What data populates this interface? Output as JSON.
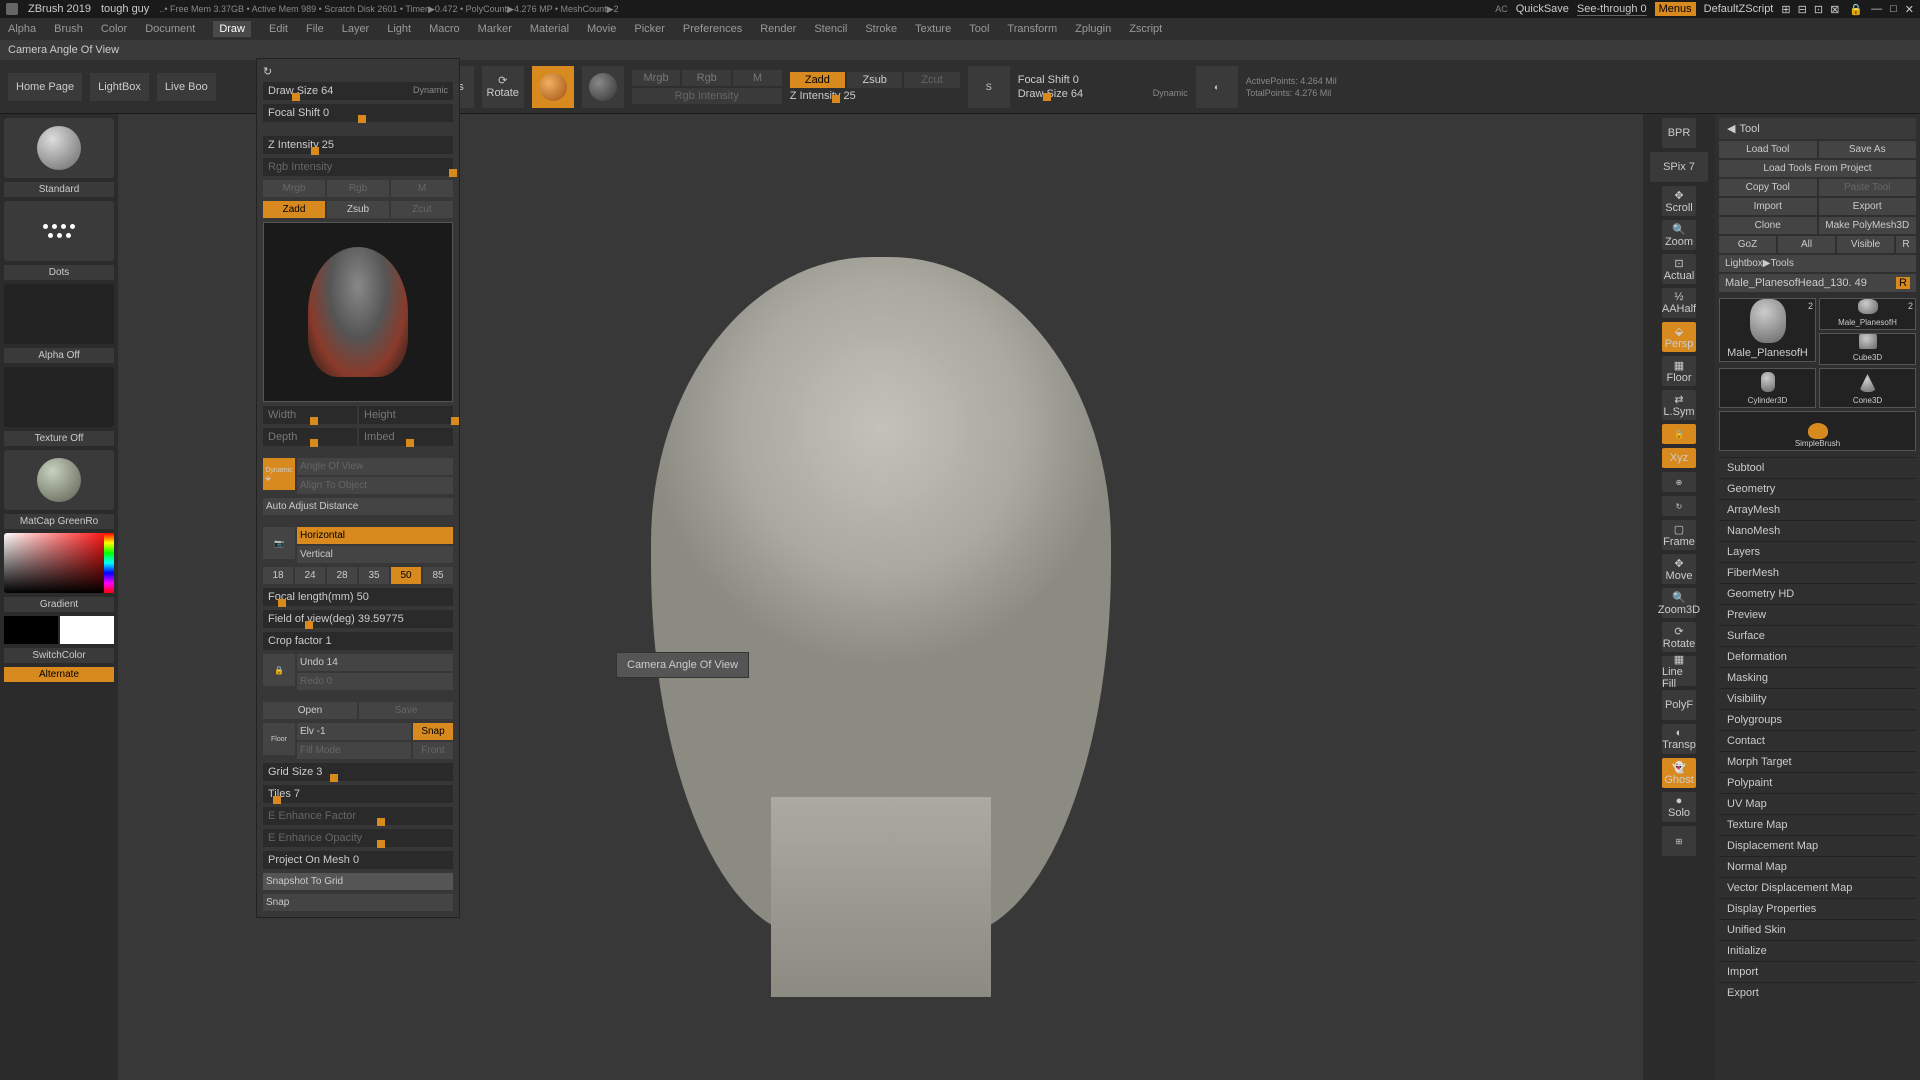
{
  "title": {
    "app": "ZBrush 2019",
    "project": "tough guy",
    "status": "..• Free Mem 3.37GB • Active Mem 989 • Scratch Disk 2601 • Timer▶0.472 • PolyCount▶4.276 MP • MeshCount▶2"
  },
  "titlebar_right": {
    "ac": "AC",
    "quicksave": "QuickSave",
    "seethrough": "See-through  0",
    "menus": "Menus",
    "zscript": "DefaultZScript"
  },
  "menu": [
    "Alpha",
    "Brush",
    "Color",
    "Document",
    "Draw",
    "Edit",
    "File",
    "Layer",
    "Light",
    "Macro",
    "Marker",
    "Material",
    "Movie",
    "Picker",
    "Preferences",
    "Render",
    "Stencil",
    "Stroke",
    "Texture",
    "Tool",
    "Transform",
    "Zplugin",
    "Zscript"
  ],
  "menu_active": "Draw",
  "subheader": "Camera Angle Of View",
  "topbar": {
    "homepage": "Home Page",
    "lightbox": "LightBox",
    "liveboo": "Live Boo",
    "drawsize": "Draw Size 64",
    "focalshift": "Focal Shift 0",
    "dynamic": "Dynamic",
    "cals": "Cals",
    "rotate": "Rotate",
    "mrgb": "Mrgb",
    "rgb": "Rgb",
    "m": "M",
    "rgbintensity": "Rgb Intensity",
    "zadd": "Zadd",
    "zsub": "Zsub",
    "zcut": "Zcut",
    "zintensity": "Z Intensity 25",
    "focalshift2": "Focal Shift 0",
    "drawsize2": "Draw Size 64",
    "dynamic2": "Dynamic",
    "activepoints": "ActivePoints: 4.264 Mil",
    "totalpoints": "TotalPoints: 4.276 Mil"
  },
  "left": {
    "standard": "Standard",
    "dots": "Dots",
    "alphaoff": "Alpha Off",
    "textureoff": "Texture Off",
    "matcap": "MatCap GreenRo",
    "gradient": "Gradient",
    "switchcolor": "SwitchColor",
    "alternate": "Alternate"
  },
  "panel": {
    "drawsize": "Draw Size 64",
    "focalshift": "Focal Shift 0",
    "dynamic": "Dynamic",
    "zintensity": "Z Intensity 25",
    "rgbintensity": "Rgb Intensity",
    "mrgb": "Mrgb",
    "rgb": "Rgb",
    "m": "M",
    "zadd": "Zadd",
    "zsub": "Zsub",
    "zcut": "Zcut",
    "width": "Width",
    "height": "Height",
    "depth": "Depth",
    "imbed": "Imbed",
    "persp": "Persp",
    "angleofview": "Angle Of View",
    "aligntoobject": "Align To Object",
    "autoadjust": "Auto Adjust Distance",
    "horizontal": "Horizontal",
    "vertical": "Vertical",
    "fl": [
      "18",
      "24",
      "28",
      "35",
      "50",
      "85"
    ],
    "focallength": "Focal length(mm) 50",
    "fov": "Field of view(deg) 39.59775",
    "crop": "Crop factor 1",
    "undo": "Undo 14",
    "redo": "Redo 0",
    "open": "Open",
    "save": "Save",
    "elv": "Elv -1",
    "snap": "Snap",
    "fillmode": "Fill Mode",
    "front": "Front",
    "floor": "Floor",
    "gridsize": "Grid Size 3",
    "tiles": "Tiles 7",
    "enhancef": "E Enhance Factor",
    "enhanceo": "E Enhance Opacity",
    "projectonmesh": "Project On Mesh 0",
    "snapshottogrid": "Snapshot To Grid",
    "snap2": "Snap"
  },
  "tooltip": "Camera Angle Of View",
  "shelf": {
    "bpr": "BPR",
    "spix": "SPix 7",
    "scroll": "Scroll",
    "zoom": "Zoom",
    "actual": "Actual",
    "aahalf": "AAHalf",
    "persp": "Persp",
    "floor": "Floor",
    "lsym": "L.Sym",
    "xyz": "Xyz",
    "frame": "Frame",
    "move": "Move",
    "zoom3d": "Zoom3D",
    "rotate": "Rotate",
    "linefill": "Line Fill",
    "polyf": "PolyF",
    "transp": "Transp",
    "ghost": "Ghost",
    "solo": "Solo"
  },
  "tool": {
    "header": "Tool",
    "loadtool": "Load Tool",
    "saveas": "Save As",
    "loadfromproject": "Load Tools From Project",
    "copytool": "Copy Tool",
    "pastetool": "Paste Tool",
    "import": "Import",
    "export": "Export",
    "clone": "Clone",
    "makepolymesh": "Make PolyMesh3D",
    "goz": "GoZ",
    "all": "All",
    "visible": "Visible",
    "r": "R",
    "lightboxtools": "Lightbox▶Tools",
    "current": "Male_PlanesofHead_130. 49",
    "thumbs": [
      {
        "name": "Male_PlanesofH",
        "badge": "2"
      },
      {
        "name": "Male_PlanesofH",
        "badge": "2"
      },
      {
        "name": "Cube3D",
        "badge": ""
      },
      {
        "name": "Cylinder3D",
        "badge": ""
      },
      {
        "name": "Cone3D",
        "badge": ""
      },
      {
        "name": "SimpleBrush",
        "badge": ""
      }
    ],
    "sections": [
      "Subtool",
      "Geometry",
      "ArrayMesh",
      "NanoMesh",
      "Layers",
      "FiberMesh",
      "Geometry HD",
      "Preview",
      "Surface",
      "Deformation",
      "Masking",
      "Visibility",
      "Polygroups",
      "Contact",
      "Morph Target",
      "Polypaint",
      "UV Map",
      "Texture Map",
      "Displacement Map",
      "Normal Map",
      "Vector Displacement Map",
      "Display Properties",
      "Unified Skin",
      "Initialize",
      "Import",
      "Export"
    ]
  }
}
